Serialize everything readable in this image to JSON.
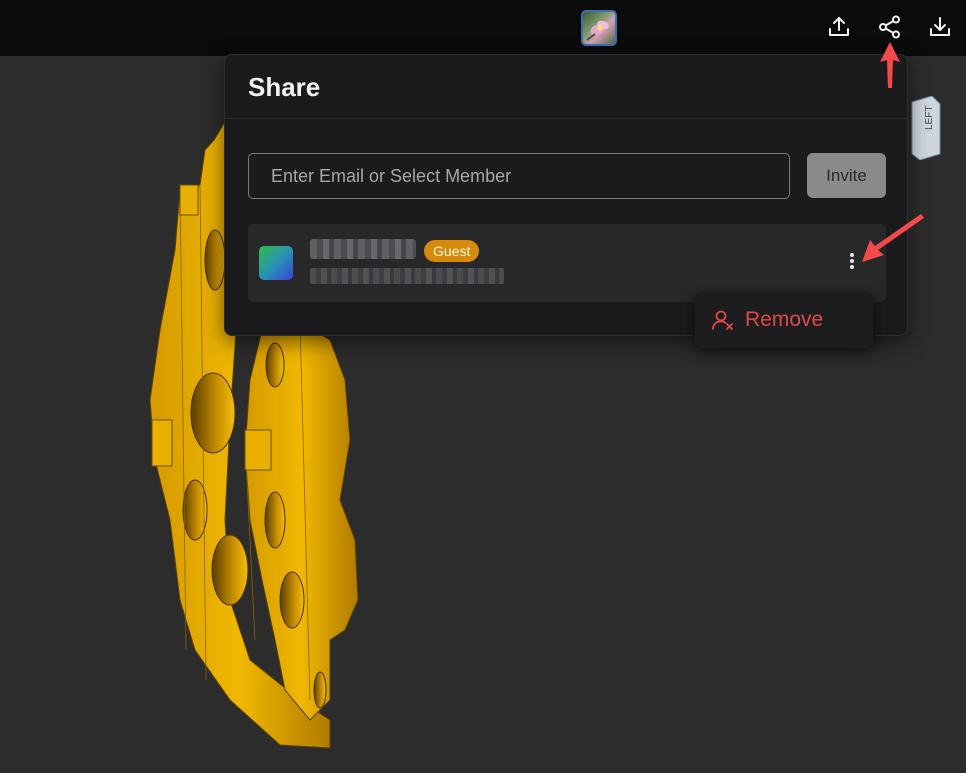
{
  "topbar": {
    "avatar": "shared-model-thumbnail",
    "icons": [
      "upload-icon",
      "share-icon",
      "download-icon"
    ]
  },
  "viewcube": {
    "face_label": "LEFT"
  },
  "share_panel": {
    "title": "Share",
    "email_input": {
      "value": "",
      "placeholder": "Enter Email or Select Member"
    },
    "invite_label": "Invite",
    "members": [
      {
        "name": "••••••••••",
        "email": "••••••••••••••••••••",
        "role": "Guest"
      }
    ]
  },
  "context_menu": {
    "items": [
      {
        "label": "Remove",
        "icon": "remove-user-icon"
      }
    ]
  },
  "colors": {
    "background": "#2c2c2c",
    "topbar": "#0b0b0c",
    "panel": "#1b1b1d",
    "guest_badge": "#d68a0a",
    "remove": "#e04848",
    "annotation_arrow": "#f24a4a",
    "model": "#e0a800"
  }
}
